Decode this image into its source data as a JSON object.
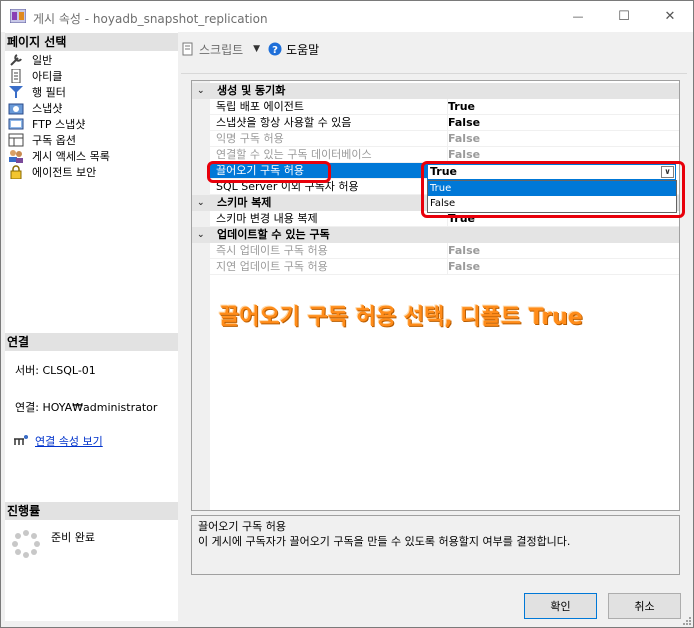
{
  "window": {
    "title": "게시 속성 - hoyadb_snapshot_replication",
    "minimize": "—",
    "maximize": "☐",
    "close": "✕"
  },
  "left": {
    "page_select_header": "페이지 선택",
    "pages": [
      {
        "label": "일반",
        "icon": "wrench-icon"
      },
      {
        "label": "아티클",
        "icon": "article-icon"
      },
      {
        "label": "행 필터",
        "icon": "filter-icon"
      },
      {
        "label": "스냅샷",
        "icon": "snapshot-icon"
      },
      {
        "label": "FTP 스냅샷",
        "icon": "ftp-icon"
      },
      {
        "label": "구독 옵션",
        "icon": "subscription-options-icon"
      },
      {
        "label": "게시 액세스 목록",
        "icon": "access-list-icon"
      },
      {
        "label": "에이전트 보안",
        "icon": "lock-icon"
      }
    ],
    "connection_header": "연결",
    "server": "서버: CLSQL-01",
    "connection": "연결: HOYA₩administrator",
    "view_props_link": "연결 속성 보기",
    "progress_header": "진행률",
    "progress_status": "준비 완료"
  },
  "toolbar": {
    "script_label": "스크립트",
    "help_label": "도움말"
  },
  "grid": {
    "categories": [
      {
        "label": "생성 및 동기화",
        "rows": [
          {
            "name": "독립 배포 에이전트",
            "value": "True",
            "dim": false
          },
          {
            "name": "스냅샷을 항상 사용할 수 있음",
            "value": "False",
            "dim": false
          },
          {
            "name": "익명 구독 허용",
            "value": "False",
            "dim": true
          },
          {
            "name": "연결할 수 있는 구독 데이터베이스",
            "value": "False",
            "dim": true
          },
          {
            "name": "끌어오기 구독 허용",
            "value": "True",
            "dim": false,
            "selected": true
          },
          {
            "name": "SQL Server 이외 구독자 허용",
            "value": "",
            "dim": false
          }
        ]
      },
      {
        "label": "스키마 복제",
        "rows": [
          {
            "name": "스키마 변경 내용 복제",
            "value": "True",
            "dim": false
          }
        ]
      },
      {
        "label": "업데이트할 수 있는 구독",
        "rows": [
          {
            "name": "즉시 업데이트 구독 허용",
            "value": "False",
            "dim": true
          },
          {
            "name": "지연 업데이트 구독 허용",
            "value": "False",
            "dim": true
          }
        ]
      }
    ],
    "dropdown": {
      "current": "True",
      "options": [
        "True",
        "False"
      ],
      "highlighted": "True"
    }
  },
  "annotation": "끌어오기 구독 허용 선택, 디폴트 True",
  "description": {
    "title": "끌어오기 구독 허용",
    "text": "이 게시에 구독자가 끌어오기 구독을 만들 수 있도록 허용할지 여부를 결정합니다."
  },
  "buttons": {
    "ok": "확인",
    "cancel": "취소"
  },
  "colors": {
    "selection": "#0078d7",
    "annotation_red": "#e8000b",
    "annotation_text": "#ff8c1a"
  }
}
